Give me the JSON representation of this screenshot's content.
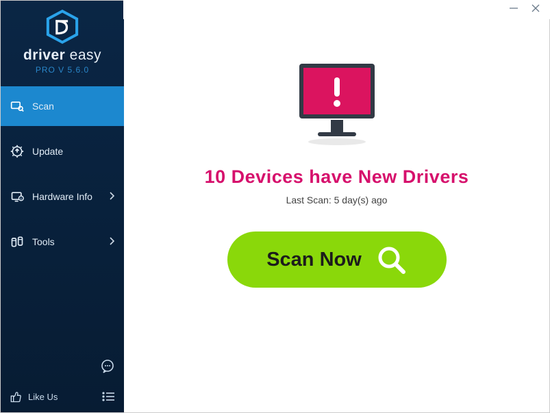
{
  "brand": {
    "name_left": "driver",
    "name_right": " easy",
    "version": "PRO V 5.6.0"
  },
  "nav": {
    "scan": "Scan",
    "update": "Update",
    "hardware": "Hardware Info",
    "tools": "Tools"
  },
  "footer": {
    "like_us": "Like Us"
  },
  "main": {
    "headline": "10 Devices have New Drivers",
    "last_scan": "Last Scan: 5 day(s) ago",
    "scan_button": "Scan Now"
  }
}
